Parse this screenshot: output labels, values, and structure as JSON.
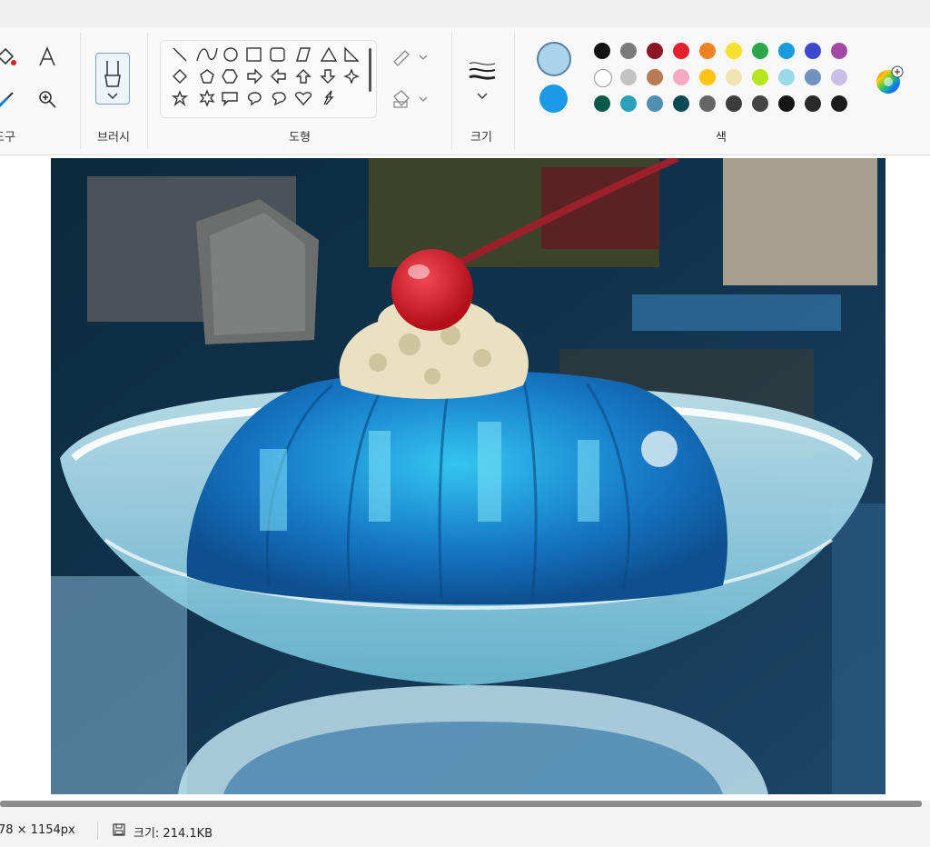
{
  "ribbon": {
    "tools_label": "도구",
    "brush_label": "브러시",
    "shapes_label": "도형",
    "size_label": "크기",
    "colors_label": "색"
  },
  "colors": {
    "current_primary": "#aad4ea",
    "current_secondary": "#1a9ae6",
    "palette": [
      "#111111",
      "#7a7a7a",
      "#8b1525",
      "#e7222e",
      "#f08326",
      "#f5e12e",
      "#2ba84a",
      "#1b9bdc",
      "#3f48cc",
      "#a349a4",
      "#ffffff",
      "#c3c3c3",
      "#b97a57",
      "#f5a9c3",
      "#ffc20e",
      "#efe4b0",
      "#b5e61d",
      "#99d9ea",
      "#7092be",
      "#c8bfe7",
      "#0a5a4a",
      "#2aa1b8",
      "#4f8fb3",
      "#0b4b57",
      "#666666",
      "#3d3d3d",
      "#444444",
      "#151515",
      "#2a2a2a",
      "#1c1c1c"
    ]
  },
  "status": {
    "dimensions": "78 × 1154px",
    "size_text": "크기: 214.1KB"
  }
}
